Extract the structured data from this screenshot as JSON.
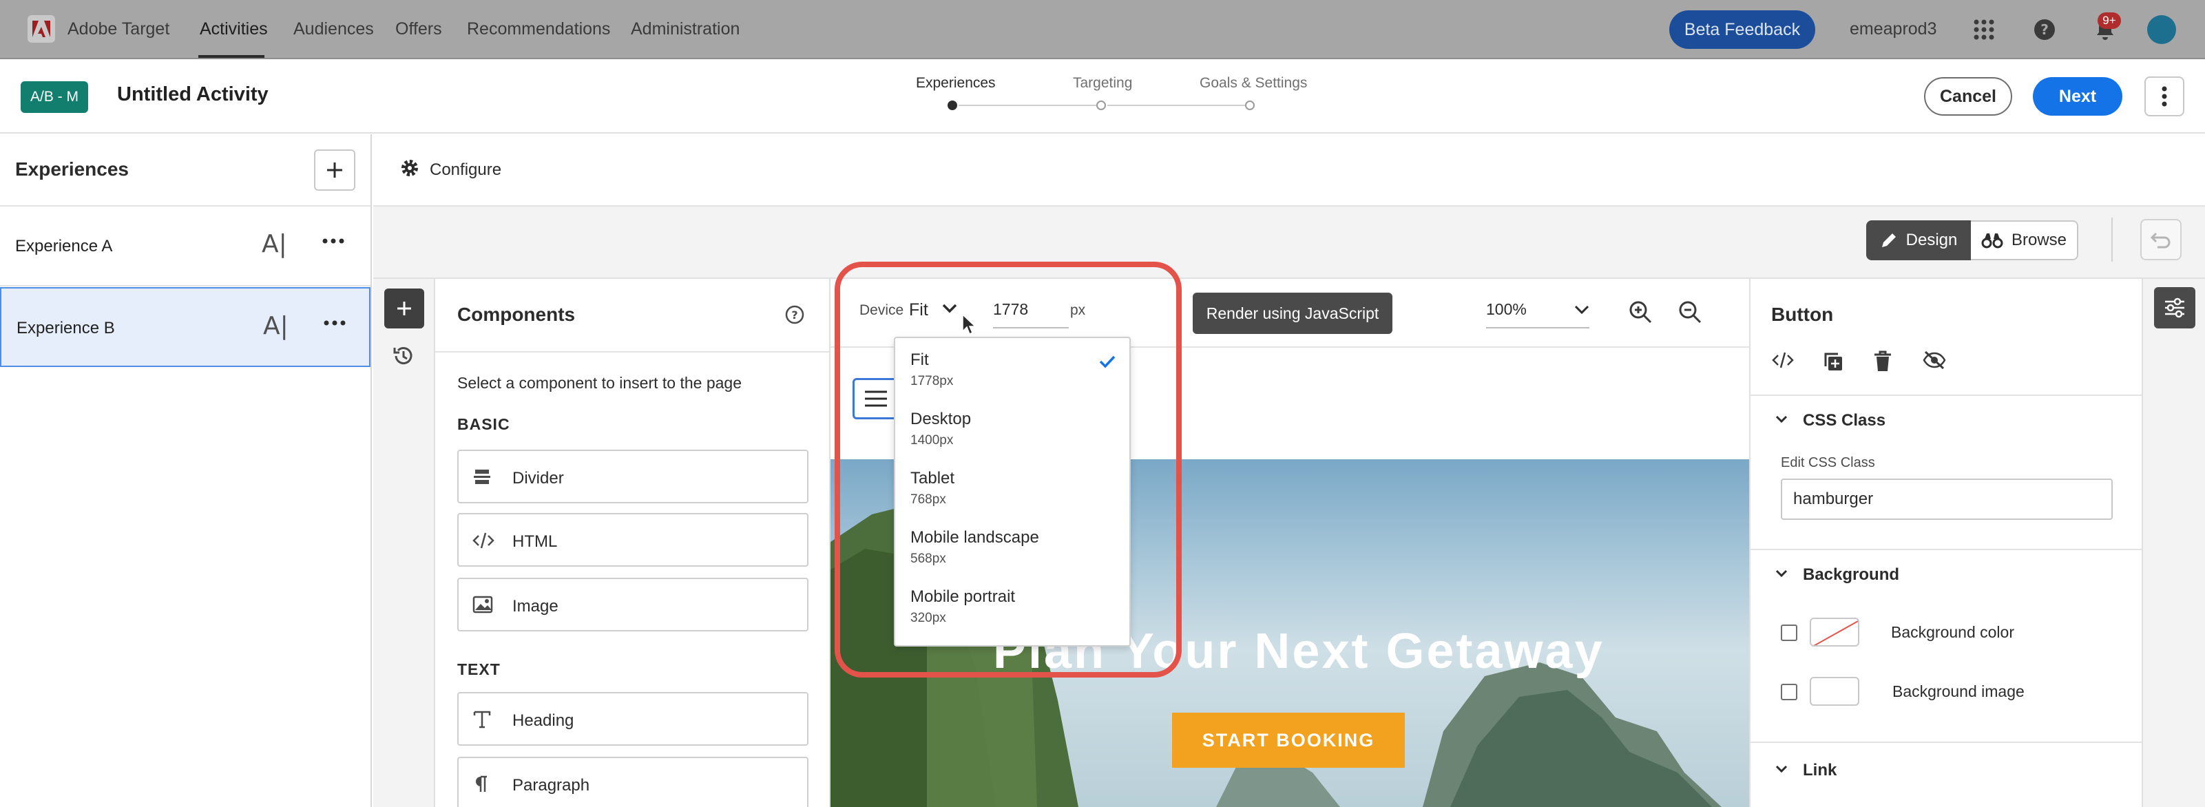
{
  "topnav": {
    "product": "Adobe Target",
    "items": [
      "Activities",
      "Audiences",
      "Offers",
      "Recommendations",
      "Administration"
    ],
    "beta_feedback": "Beta Feedback",
    "org": "emeaprod3",
    "notification_count": "9+"
  },
  "activity": {
    "badge": "A/B - M",
    "title": "Untitled Activity",
    "steps": [
      "Experiences",
      "Targeting",
      "Goals & Settings"
    ],
    "cancel": "Cancel",
    "next": "Next"
  },
  "experiences": {
    "title": "Experiences",
    "items": [
      {
        "label": "Experience A",
        "ai": "A|"
      },
      {
        "label": "Experience B",
        "ai": "A|"
      }
    ]
  },
  "configure": {
    "label": "Configure"
  },
  "mode": {
    "design": "Design",
    "browse": "Browse"
  },
  "components": {
    "title": "Components",
    "description": "Select a component to insert to the page",
    "sections": [
      {
        "title": "BASIC",
        "items": [
          "Divider",
          "HTML",
          "Image"
        ]
      },
      {
        "title": "TEXT",
        "items": [
          "Heading",
          "Paragraph"
        ]
      }
    ]
  },
  "canvas": {
    "device_label": "Device",
    "device_value": "Fit",
    "width_value": "1778",
    "width_unit": "px",
    "render_button": "Render using JavaScript",
    "zoom": "100%",
    "hero_title": "Plan Your Next Getaway",
    "hero_cta": "START BOOKING"
  },
  "device_options": [
    {
      "name": "Fit",
      "size": "1778px",
      "selected": true
    },
    {
      "name": "Desktop",
      "size": "1400px",
      "selected": false
    },
    {
      "name": "Tablet",
      "size": "768px",
      "selected": false
    },
    {
      "name": "Mobile landscape",
      "size": "568px",
      "selected": false
    },
    {
      "name": "Mobile portrait",
      "size": "320px",
      "selected": false
    }
  ],
  "properties": {
    "title": "Button",
    "css_section": "CSS Class",
    "css_label": "Edit CSS Class",
    "css_value": "hamburger",
    "background_section": "Background",
    "bg_color_label": "Background color",
    "bg_image_label": "Background image",
    "link_section": "Link"
  },
  "colors": {
    "primary": "#1473e6",
    "badge": "#117e6e",
    "highlight": "#e4534a",
    "cta": "#f2a21f"
  }
}
